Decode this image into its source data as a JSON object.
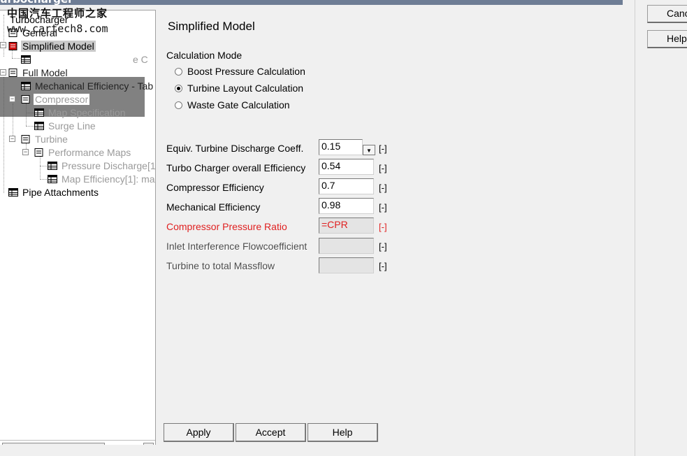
{
  "window": {
    "title": "urbocharger"
  },
  "watermark": {
    "line1": "中国汽车工程师之家",
    "line2": "www.cartech8.com"
  },
  "tree": {
    "root": "Turbocharger",
    "general": "General",
    "simplified_model": "Simplified Model",
    "simplified_child_partial": "e C",
    "full_model": "Full Model",
    "mechanical_efficiency": "Mechanical Efficiency - Tab",
    "compressor": "Compressor",
    "map_specification": "Map Specification",
    "surge_line": "Surge Line",
    "turbine": "Turbine",
    "performance_maps": "Performance Maps",
    "pressure_discharge": "Pressure Discharge[1",
    "map_efficiency": "Map Efficiency[1]: ma",
    "pipe_attachments": "Pipe Attachments"
  },
  "form": {
    "title": "Simplified Model",
    "calculation_mode_label": "Calculation Mode",
    "calculation_modes": [
      {
        "label": "Boost Pressure Calculation",
        "selected": false
      },
      {
        "label": "Turbine Layout Calculation",
        "selected": true
      },
      {
        "label": "Waste Gate Calculation",
        "selected": false
      }
    ],
    "fields": [
      {
        "label": "Equiv. Turbine Discharge Coeff.",
        "value": "0.15",
        "unit": "[-]"
      },
      {
        "label": "Turbo Charger overall Efficiency",
        "value": "0.54",
        "unit": "[-]"
      },
      {
        "label": "Compressor Efficiency",
        "value": "0.7",
        "unit": "[-]"
      },
      {
        "label": "Mechanical Efficiency",
        "value": "0.98",
        "unit": "[-]"
      },
      {
        "label": "Compressor Pressure Ratio",
        "value": "=CPR",
        "unit": "[-]"
      },
      {
        "label": "Inlet Interference Flowcoefficient",
        "value": "",
        "unit": "[-]"
      },
      {
        "label": "Turbine to total Massflow",
        "value": "",
        "unit": "[-]"
      }
    ],
    "buttons": {
      "apply": "Apply",
      "accept": "Accept",
      "help": "Help"
    }
  },
  "side_buttons": {
    "cancel": "Canc",
    "help": "Help"
  },
  "colors": {
    "accent_red": "#e02020",
    "title_bar": "#6e7d95"
  }
}
